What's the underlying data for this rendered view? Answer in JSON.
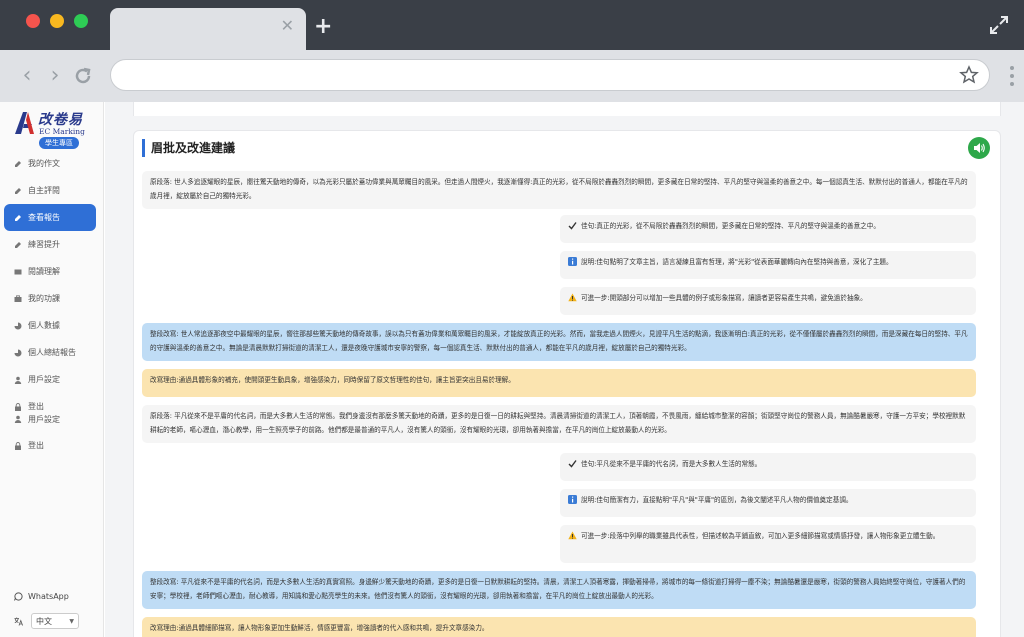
{
  "sidebar": {
    "logo_cn": "改卷易",
    "logo_en": "EC Marking",
    "badge": "學生專區",
    "items": [
      {
        "label": "我的作文",
        "icon": "edit-icon"
      },
      {
        "label": "自主評閱",
        "icon": "edit-icon"
      },
      {
        "label": "查看報告",
        "icon": "edit-icon",
        "active": true
      },
      {
        "label": "練習提升",
        "icon": "edit-icon"
      },
      {
        "label": "閱讀理解",
        "icon": "book-icon"
      },
      {
        "label": "我的功課",
        "icon": "briefcase-icon"
      },
      {
        "label": "個人數據",
        "icon": "chart-icon"
      },
      {
        "label": "個人總結報告",
        "icon": "chart-icon"
      },
      {
        "label": "用戶設定",
        "icon": "user-icon"
      },
      {
        "label": "登出",
        "icon": "lock-icon"
      },
      {
        "label": "用戶設定",
        "icon": "user-icon"
      },
      {
        "label": "登出",
        "icon": "lock-icon"
      }
    ],
    "whatsapp": "WhatsApp",
    "lang_label": "中文"
  },
  "main": {
    "section_title": "眉批及改進建議",
    "blocks": [
      {
        "kind": "orig",
        "text": "原段落: 世人多追逐耀眼的星辰，嚮往驚天動地的傳奇，以為光彩只屬於蓋功偉業與萬眾矚目的風采。但走過人間煙火，我逐漸懂得:真正的光彩，從不局限於轟轟烈烈的瞬間，更多藏在日常的堅持、平凡的堅守與溫柔的善意之中。每一個認真生活、默默付出的普通人，都能在平凡的歲月裡，綻放屬於自己的獨特光彩。"
      },
      {
        "kind": "good",
        "text": "佳句:真正的光彩，從不局限於轟轟烈烈的瞬間，更多藏在日常的堅持、平凡的堅守與溫柔的善意之中。"
      },
      {
        "kind": "info",
        "text": "說明:佳句點明了文章主旨，語言凝練且富有哲理，將\"光彩\"從表面華麗轉向內在堅持與善意，深化了主題。"
      },
      {
        "kind": "warn",
        "text": "可進一步:開頭部分可以增加一些具體的例子或形象描寫，讓讀者更容易產生共鳴，避免過於抽象。"
      },
      {
        "kind": "revised",
        "text": "整段改寫: 世人常追逐那夜空中最耀眼的星辰，嚮往那部些驚天動地的傳奇故事，誤以為只有蓋功偉業和萬眾矚目的風采，才能綻放真正的光彩。然而，當我走過人間煙火，見證平凡生活的點滴，我逐漸明白:真正的光彩，從不僅僅屬於轟轟烈烈的瞬間，而是深藏在每日的堅持、平凡的守護與溫柔的善意之中。無論是清晨默默打掃街道的清潔工人，還是夜晚守護城市安寧的警察，每一個認真生活、默默付出的普通人，都能在平凡的歲月裡，綻放屬於自己的獨特光彩。"
      },
      {
        "kind": "reason",
        "text": "改寫理由:通過具體形象的補充，使開頭更生動具象，增強感染力，同時保留了原文哲理性的佳句，讓主旨更突出且易於理解。"
      },
      {
        "kind": "orig",
        "text": "原段落: 平凡從來不是平庸的代名詞，而是大多數人生活的常態。我們身邊沒有那麼多驚天動地的奇蹟，更多的是日復一日的耕耘與堅持。清晨清掃街道的清潔工人，頂著朝霞，不畏風雨，纏給城市整潔的容顏；街頭堅守崗位的警務人員，無論酷暑嚴寒，守護一方平安；學校裡默默耕耘的老師，嘔心瀝血，潛心教學，用一生照亮學子的前路。他們都是最普通的平凡人，沒有驚人的頭銜，沒有耀眼的光環，卻用執著與擔當，在平凡的崗位上綻放最動人的光彩。"
      },
      {
        "kind": "good",
        "text": "佳句:平凡從來不是平庸的代名詞，而是大多數人生活的常態。"
      },
      {
        "kind": "info",
        "text": "說明:佳句簡潔有力，直接點明\"平凡\"與\"平庸\"的區別，為後文闡述平凡人物的價值奠定基調。"
      },
      {
        "kind": "warn",
        "text": "可進一步:段落中列舉的職業雖具代表性，但描述較為平鋪直敘，可加入更多細節描寫或情感抒發，讓人物形象更立體生動。"
      },
      {
        "kind": "revised",
        "text": "整段改寫: 平凡從來不是平庸的代名詞，而是大多數人生活的真實寫照。身邊鮮少驚天動地的奇蹟，更多的是日復一日默默耕耘的堅持。清晨，清潔工人頂著寒露，揮動著掃帚，將城市的每一條街道打掃得一塵不染；無論酷暑還是嚴寒，街頭的警務人員始終堅守崗位，守護著人們的安寧；學校裡，老師們嘔心瀝血，耐心教導，用知識和愛心點亮學生的未來。他們沒有驚人的頭銜，沒有耀眼的光環，卻用執著和擔當，在平凡的崗位上綻放出最動人的光彩。"
      },
      {
        "kind": "reason",
        "text": "改寫理由:通過具體細節描寫，讓人物形象更加生動鮮活，情感更豐富，增強讀者的代入感和共鳴，提升文章感染力。"
      }
    ]
  }
}
